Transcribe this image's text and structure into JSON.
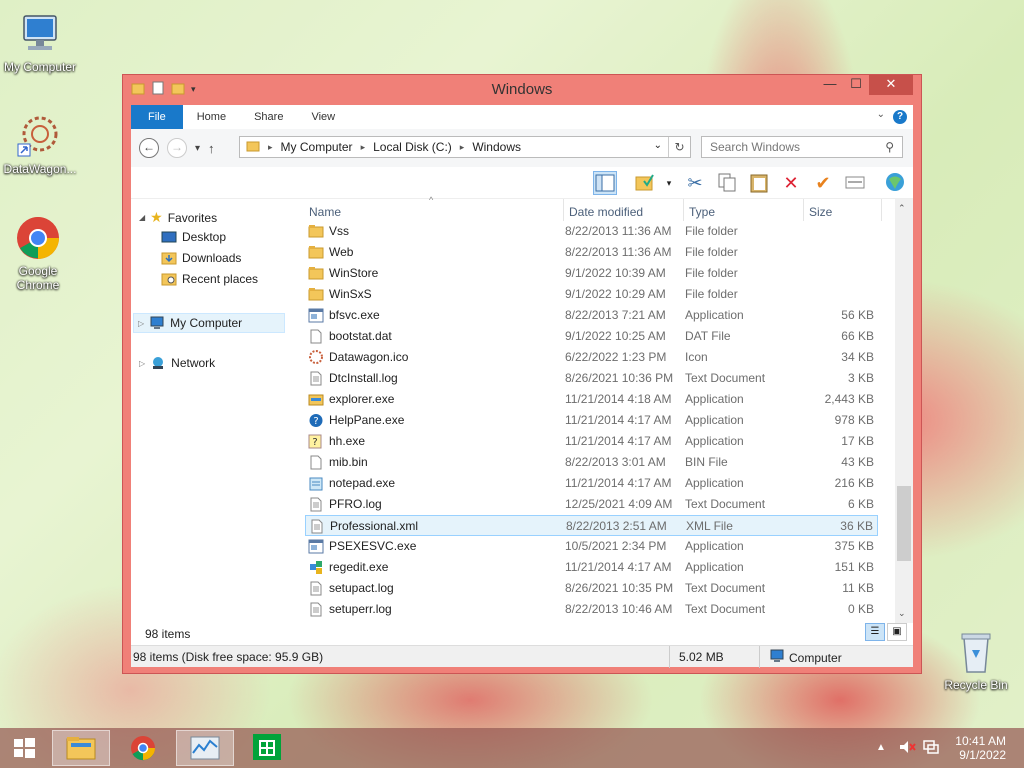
{
  "desktop": {
    "icons": [
      {
        "label": "My Computer"
      },
      {
        "label": "DataWagon..."
      },
      {
        "label": "Google Chrome"
      },
      {
        "label": "Recycle Bin"
      }
    ]
  },
  "window": {
    "title": "Windows",
    "ribbon_tabs": [
      "File",
      "Home",
      "Share",
      "View"
    ],
    "address": {
      "crumbs": [
        "My Computer",
        "Local Disk (C:)",
        "Windows"
      ]
    },
    "search_placeholder": "Search Windows",
    "nav": {
      "favorites": "Favorites",
      "desktop": "Desktop",
      "downloads": "Downloads",
      "recent": "Recent places",
      "my_computer": "My Computer",
      "network": "Network"
    },
    "columns": {
      "name": "Name",
      "date": "Date modified",
      "type": "Type",
      "size": "Size"
    },
    "files": [
      {
        "name": "Vss",
        "date": "8/22/2013 11:36 AM",
        "type": "File folder",
        "size": "",
        "icon": "folder-icon"
      },
      {
        "name": "Web",
        "date": "8/22/2013 11:36 AM",
        "type": "File folder",
        "size": "",
        "icon": "folder-icon"
      },
      {
        "name": "WinStore",
        "date": "9/1/2022 10:39 AM",
        "type": "File folder",
        "size": "",
        "icon": "folder-icon"
      },
      {
        "name": "WinSxS",
        "date": "9/1/2022 10:29 AM",
        "type": "File folder",
        "size": "",
        "icon": "folder-icon"
      },
      {
        "name": "bfsvc.exe",
        "date": "8/22/2013 7:21 AM",
        "type": "Application",
        "size": "56 KB",
        "icon": "exe-icon"
      },
      {
        "name": "bootstat.dat",
        "date": "9/1/2022 10:25 AM",
        "type": "DAT File",
        "size": "66 KB",
        "icon": "file-icon"
      },
      {
        "name": "Datawagon.ico",
        "date": "6/22/2022 1:23 PM",
        "type": "Icon",
        "size": "34 KB",
        "icon": "ico-icon"
      },
      {
        "name": "DtcInstall.log",
        "date": "8/26/2021 10:36 PM",
        "type": "Text Document",
        "size": "3 KB",
        "icon": "text-icon"
      },
      {
        "name": "explorer.exe",
        "date": "11/21/2014 4:18 AM",
        "type": "Application",
        "size": "2,443 KB",
        "icon": "explorer-icon"
      },
      {
        "name": "HelpPane.exe",
        "date": "11/21/2014 4:17 AM",
        "type": "Application",
        "size": "978 KB",
        "icon": "help-icon"
      },
      {
        "name": "hh.exe",
        "date": "11/21/2014 4:17 AM",
        "type": "Application",
        "size": "17 KB",
        "icon": "hh-icon"
      },
      {
        "name": "mib.bin",
        "date": "8/22/2013 3:01 AM",
        "type": "BIN File",
        "size": "43 KB",
        "icon": "file-icon"
      },
      {
        "name": "notepad.exe",
        "date": "11/21/2014 4:17 AM",
        "type": "Application",
        "size": "216 KB",
        "icon": "notepad-icon"
      },
      {
        "name": "PFRO.log",
        "date": "12/25/2021 4:09 AM",
        "type": "Text Document",
        "size": "6 KB",
        "icon": "text-icon"
      },
      {
        "name": "Professional.xml",
        "date": "8/22/2013 2:51 AM",
        "type": "XML File",
        "size": "36 KB",
        "icon": "text-icon"
      },
      {
        "name": "PSEXESVC.exe",
        "date": "10/5/2021 2:34 PM",
        "type": "Application",
        "size": "375 KB",
        "icon": "exe-icon"
      },
      {
        "name": "regedit.exe",
        "date": "11/21/2014 4:17 AM",
        "type": "Application",
        "size": "151 KB",
        "icon": "regedit-icon"
      },
      {
        "name": "setupact.log",
        "date": "8/26/2021 10:35 PM",
        "type": "Text Document",
        "size": "11 KB",
        "icon": "text-icon"
      },
      {
        "name": "setuperr.log",
        "date": "8/22/2013 10:46 AM",
        "type": "Text Document",
        "size": "0 KB",
        "icon": "text-icon"
      }
    ],
    "selected_file": "Professional.xml",
    "items_count": "98 items",
    "status": {
      "left": "98 items (Disk free space: 95.9 GB)",
      "size": "5.02 MB",
      "location": "Computer"
    }
  },
  "taskbar": {
    "time": "10:41 AM",
    "date": "9/1/2022"
  }
}
